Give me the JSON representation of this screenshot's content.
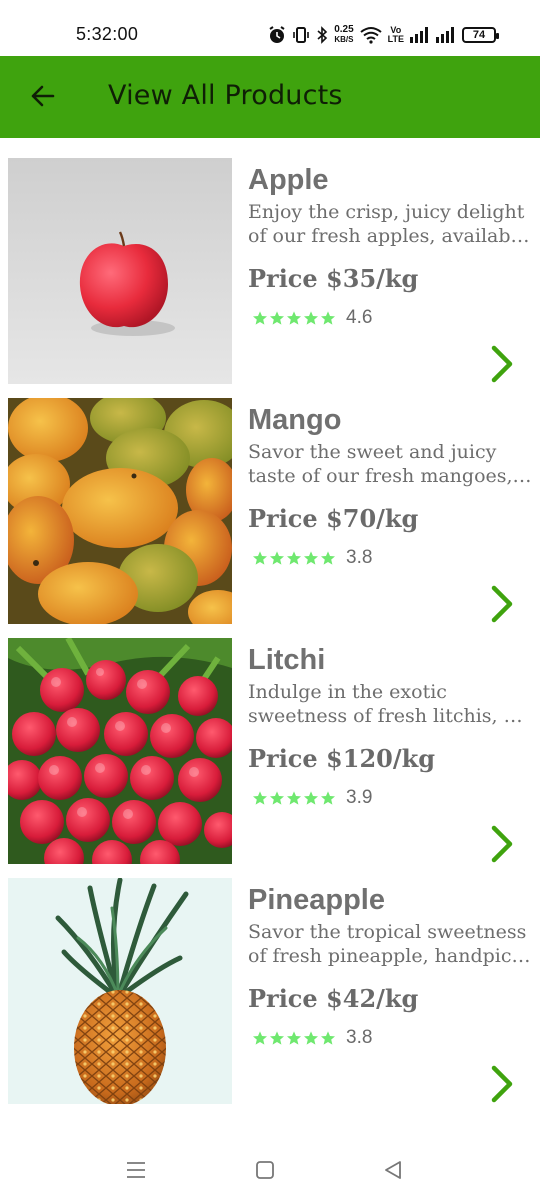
{
  "status_bar": {
    "time": "5:32:00",
    "net_speed_value": "0.25",
    "net_speed_unit": "KB/S",
    "volte_top": "Vo",
    "volte_bottom": "LTE",
    "battery": "74",
    "icons": [
      "alarm-icon",
      "vibrate-icon",
      "bluetooth-icon",
      "wifi-icon",
      "signal-icon",
      "signal-icon",
      "battery-icon"
    ]
  },
  "app_bar": {
    "title": "View All Products",
    "back_icon": "arrow-left-icon",
    "color": "#3fa30e"
  },
  "products": [
    {
      "name": "Apple",
      "desc_line1": "Enjoy the crisp, juicy delight",
      "desc_line2": "of our fresh apples, available ...",
      "price": "Price $35/kg",
      "rating": "4.6",
      "stars": 5,
      "image": "apple-photo"
    },
    {
      "name": "Mango",
      "desc_line1": "Savor the sweet and juicy",
      "desc_line2": "taste of our fresh mangoes, p...",
      "price": "Price $70/kg",
      "rating": "3.8",
      "stars": 5,
      "image": "mango-photo"
    },
    {
      "name": "Litchi",
      "desc_line1": "Indulge in the exotic",
      "desc_line2": "sweetness of fresh litchis, kn...",
      "price": "Price $120/kg",
      "rating": "3.9",
      "stars": 5,
      "image": "litchi-photo"
    },
    {
      "name": "Pineapple",
      "desc_line1": "Savor the tropical sweetness",
      "desc_line2": "of fresh pineapple, handpick...",
      "price": "Price $42/kg",
      "rating": "3.8",
      "stars": 5,
      "image": "pineapple-photo"
    }
  ],
  "colors": {
    "accent": "#3fa30e",
    "star": "#6fe86f",
    "chevron": "#3fa30e"
  },
  "nav_bar": {
    "icons": [
      "menu-icon",
      "home-square-icon",
      "back-triangle-icon"
    ]
  }
}
